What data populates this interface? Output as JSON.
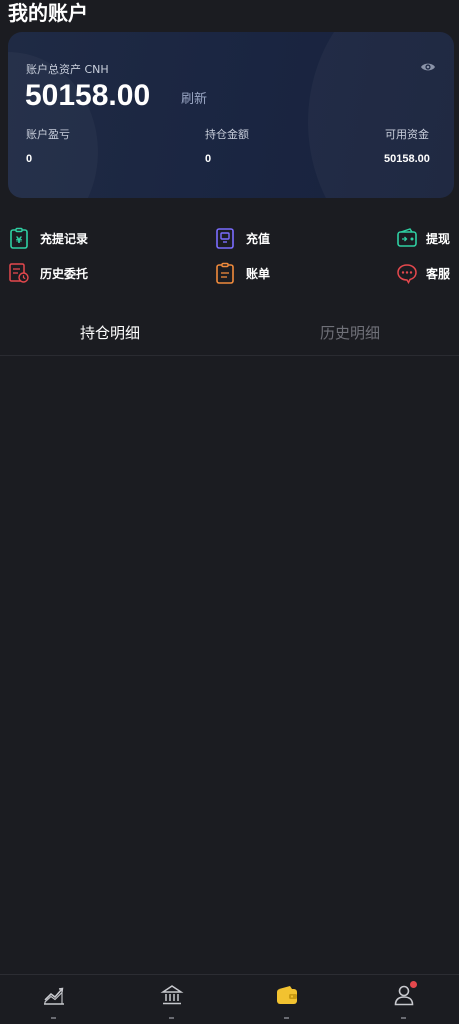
{
  "header": {
    "title": "我的账户"
  },
  "card": {
    "label": "账户总资产 CNH",
    "total": "50158.00",
    "refresh": "刷新",
    "stats": [
      {
        "label": "账户盈亏",
        "value": "0"
      },
      {
        "label": "持仓金额",
        "value": "0"
      },
      {
        "label": "可用资金",
        "value": "50158.00"
      }
    ],
    "colors": {
      "background": "#1f2a44",
      "accent": "#9aa6c4"
    }
  },
  "quick_actions": [
    {
      "label": "充提记录",
      "icon": "deposit-record-icon",
      "color": "#2fd0a3"
    },
    {
      "label": "充值",
      "icon": "recharge-icon",
      "color": "#7b6cff"
    },
    {
      "label": "提现",
      "icon": "withdraw-wallet-icon",
      "color": "#2fd0a3"
    },
    {
      "label": "历史委托",
      "icon": "history-order-icon",
      "color": "#e5484d"
    },
    {
      "label": "账单",
      "icon": "bill-icon",
      "color": "#f08a3c"
    },
    {
      "label": "客服",
      "icon": "customer-service-icon",
      "color": "#e5484d"
    }
  ],
  "tabs": [
    {
      "label": "持仓明细",
      "active": true
    },
    {
      "label": "历史明细",
      "active": false
    }
  ],
  "bottom_nav": [
    {
      "icon": "market-chart-icon",
      "active": false
    },
    {
      "icon": "bank-icon",
      "active": false
    },
    {
      "icon": "wallet-icon",
      "active": true,
      "color": "#f2c230"
    },
    {
      "icon": "user-icon",
      "active": false,
      "badge": true
    }
  ]
}
